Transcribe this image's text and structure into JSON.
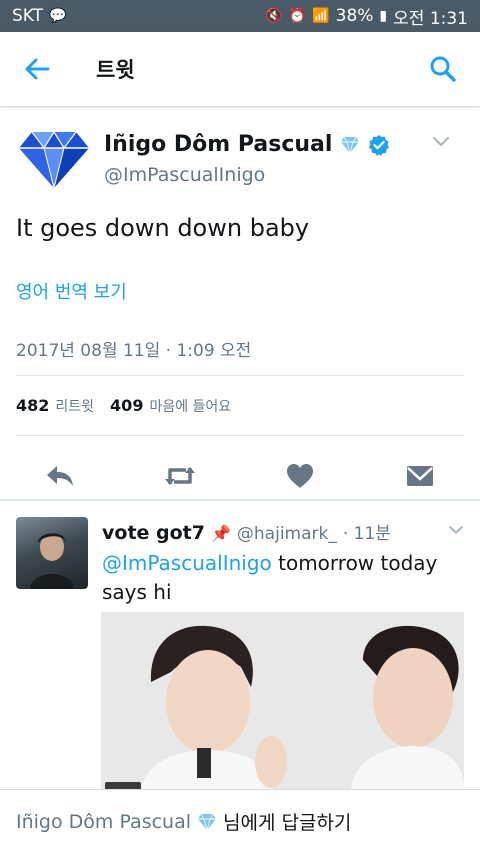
{
  "status_bar": {
    "carrier": "SKT",
    "battery": "38%",
    "time": "오전 1:31"
  },
  "app_bar": {
    "title": "트윗"
  },
  "tweet": {
    "author_name": "Iñigo Dôm Pascual",
    "handle": "@ImPascualInigo",
    "text": "It goes down down baby",
    "translate_label": "영어 번역 보기",
    "timestamp": "2017년 08월 11일 · 1:09 오전",
    "retweets_count": "482",
    "retweets_label": "리트윗",
    "likes_count": "409",
    "likes_label": "마음에 들어요"
  },
  "reply": {
    "name": "vote got7",
    "handle": "@hajimark_",
    "time": "· 11분",
    "mention": "@ImPascualInigo",
    "text": " tomorrow today says hi"
  },
  "composer": {
    "name": "Iñigo Dôm Pascual",
    "suffix": "님에게 답글하기"
  },
  "colors": {
    "accent": "#1da1f2",
    "status_bar": "#4a5a66",
    "secondary_text": "#657786"
  }
}
